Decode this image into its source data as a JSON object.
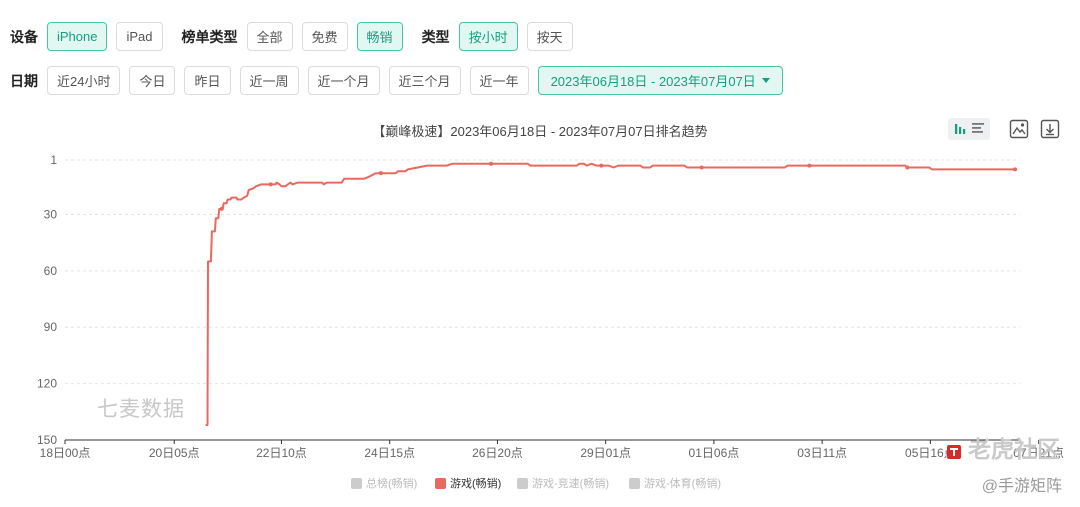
{
  "filters": {
    "device_label": "设备",
    "device_options": [
      "iPhone",
      "iPad"
    ],
    "list_type_label": "榜单类型",
    "list_type_options": [
      "全部",
      "免费",
      "畅销"
    ],
    "type_label": "类型",
    "type_options": [
      "按小时",
      "按天"
    ],
    "date_label": "日期",
    "date_options": [
      "近24小时",
      "今日",
      "昨日",
      "近一周",
      "近一个月",
      "近三个月",
      "近一年"
    ],
    "date_range": "2023年06月18日 - 2023年07月07日"
  },
  "chart_title": "【巅峰极速】2023年06月18日 - 2023年07月07日排名趋势",
  "watermark": "七麦数据",
  "site_watermark": "老虎社区",
  "site_subtext": "@手游矩阵",
  "colors": {
    "accent": "#14a07f",
    "series": "#e8695d",
    "inactive": "#cccccc"
  },
  "icons": [
    "bar-chart-icon",
    "list-icon",
    "image-icon",
    "download-icon",
    "tiger-logo-icon"
  ],
  "chart_data": {
    "type": "line",
    "title": "【巅峰极速】2023年06月18日 - 2023年07月07日排名趋势",
    "y_reversed": true,
    "ylim": [
      1,
      150
    ],
    "y_ticks": [
      1,
      30,
      60,
      90,
      120,
      150
    ],
    "x_range": [
      0,
      19.5
    ],
    "x_ticks": [
      {
        "x": 0,
        "label": "18日00点"
      },
      {
        "x": 2.23,
        "label": "20日05点"
      },
      {
        "x": 4.42,
        "label": "22日10点"
      },
      {
        "x": 6.63,
        "label": "24日15点"
      },
      {
        "x": 8.83,
        "label": "26日20点"
      },
      {
        "x": 11.04,
        "label": "29日01点"
      },
      {
        "x": 13.25,
        "label": "01日06点"
      },
      {
        "x": 15.46,
        "label": "03日11点"
      },
      {
        "x": 17.67,
        "label": "05日16点"
      },
      {
        "x": 19.88,
        "label": "07日21点"
      }
    ],
    "grid": "horizontal dashed",
    "legend_position": "bottom",
    "legend": [
      {
        "name": "总榜(畅销)",
        "active": false
      },
      {
        "name": "游戏(畅销)",
        "active": true
      },
      {
        "name": "游戏-竞速(畅销)",
        "active": false
      },
      {
        "name": "游戏-体育(畅销)",
        "active": false
      }
    ],
    "series": [
      {
        "name": "游戏(畅销)",
        "points": [
          [
            2.87,
            142
          ],
          [
            2.91,
            142
          ],
          [
            2.92,
            55
          ],
          [
            2.98,
            55
          ],
          [
            3.0,
            39
          ],
          [
            3.06,
            39
          ],
          [
            3.08,
            32
          ],
          [
            3.13,
            32
          ],
          [
            3.15,
            27
          ],
          [
            3.22,
            27
          ],
          [
            3.24,
            24
          ],
          [
            3.3,
            24
          ],
          [
            3.32,
            22
          ],
          [
            3.38,
            22
          ],
          [
            3.4,
            21
          ],
          [
            3.5,
            21
          ],
          [
            3.52,
            22
          ],
          [
            3.6,
            22
          ],
          [
            3.65,
            21
          ],
          [
            3.72,
            20
          ],
          [
            3.75,
            17
          ],
          [
            3.85,
            16
          ],
          [
            3.9,
            15
          ],
          [
            4.0,
            14
          ],
          [
            4.1,
            14
          ],
          [
            4.3,
            14
          ],
          [
            4.32,
            13
          ],
          [
            4.38,
            14
          ],
          [
            4.42,
            15
          ],
          [
            4.5,
            15
          ],
          [
            4.55,
            14
          ],
          [
            4.6,
            13
          ],
          [
            4.65,
            14
          ],
          [
            4.75,
            13
          ],
          [
            5.1,
            13
          ],
          [
            5.25,
            13
          ],
          [
            5.28,
            14
          ],
          [
            5.35,
            13
          ],
          [
            5.65,
            13
          ],
          [
            5.7,
            11
          ],
          [
            6.1,
            11
          ],
          [
            6.2,
            10
          ],
          [
            6.35,
            8
          ],
          [
            6.75,
            8
          ],
          [
            6.8,
            7
          ],
          [
            6.95,
            7
          ],
          [
            7.0,
            6
          ],
          [
            7.4,
            4
          ],
          [
            7.8,
            4
          ],
          [
            7.9,
            3
          ],
          [
            8.05,
            3
          ],
          [
            8.15,
            3
          ],
          [
            8.5,
            3
          ],
          [
            8.8,
            3
          ],
          [
            8.85,
            3
          ],
          [
            9.45,
            3
          ],
          [
            9.5,
            4
          ],
          [
            10.45,
            4
          ],
          [
            10.5,
            3
          ],
          [
            10.6,
            3
          ],
          [
            10.65,
            4
          ],
          [
            10.75,
            3
          ],
          [
            10.85,
            4
          ],
          [
            11.1,
            4
          ],
          [
            11.2,
            5
          ],
          [
            11.3,
            4
          ],
          [
            11.75,
            4
          ],
          [
            11.8,
            5
          ],
          [
            11.95,
            5
          ],
          [
            12.0,
            4
          ],
          [
            12.65,
            4
          ],
          [
            12.7,
            5
          ],
          [
            13.9,
            5
          ],
          [
            14.1,
            5
          ],
          [
            14.7,
            5
          ],
          [
            14.75,
            4
          ],
          [
            15.5,
            4
          ],
          [
            17.15,
            4
          ],
          [
            17.2,
            5
          ],
          [
            17.65,
            5
          ],
          [
            17.7,
            6
          ],
          [
            19.4,
            6
          ]
        ],
        "markers": [
          [
            3.2,
            27
          ],
          [
            4.2,
            14
          ],
          [
            6.45,
            8
          ],
          [
            8.7,
            3
          ],
          [
            10.95,
            4
          ],
          [
            13.0,
            5
          ],
          [
            15.2,
            4
          ],
          [
            17.2,
            5
          ],
          [
            19.4,
            6
          ]
        ]
      }
    ]
  }
}
